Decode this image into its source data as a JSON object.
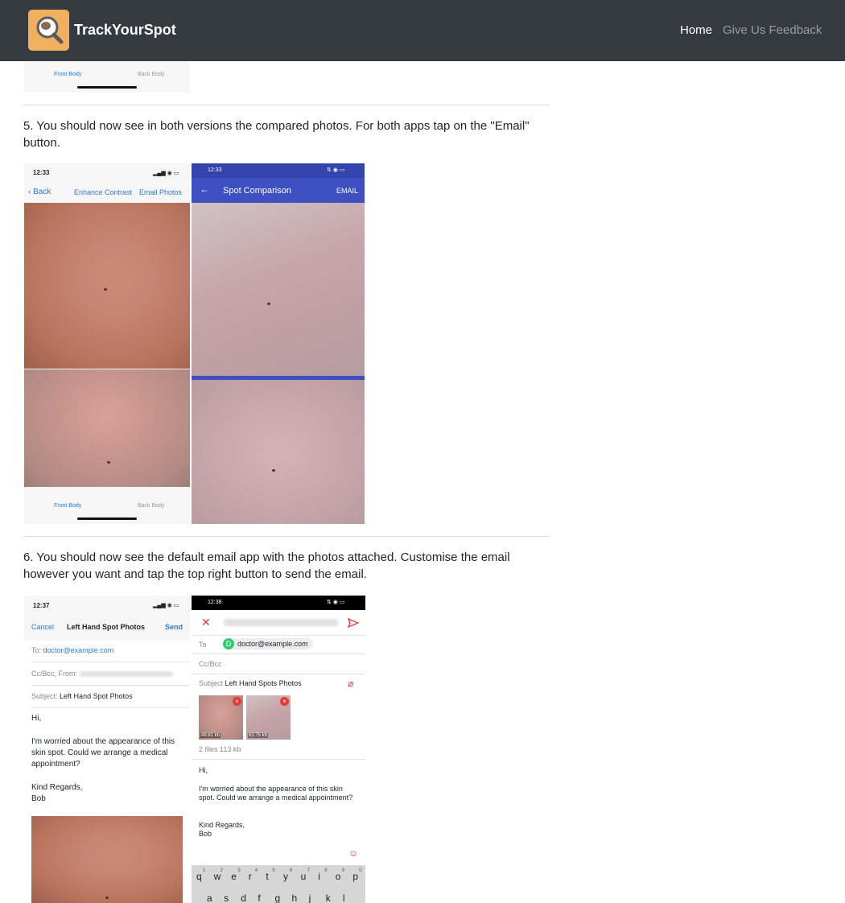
{
  "nav": {
    "brand": "TrackYourSpot",
    "home": "Home",
    "feedback": "Give Us Feedback"
  },
  "top_screenshot": {
    "front_tab": "Front Body",
    "back_tab": "Back Body"
  },
  "step5": {
    "text": "5. You should now see in both versions the compared photos. For both apps tap on the \"Email\" button.",
    "ios": {
      "time": "12:33",
      "back": "Back",
      "enhance": "Enhance Contrast",
      "email": "Email Photos",
      "front_tab": "Front Body",
      "back_tab": "Back Body"
    },
    "android": {
      "time": "12:33",
      "title": "Spot Comparison",
      "email": "EMAIL"
    }
  },
  "step6": {
    "text": "6. You should now see the default email app with the photos attached. Customise the email however you want and tap the top right button to send the email.",
    "ios": {
      "time": "12:37",
      "cancel": "Cancel",
      "title": "Left Hand Spot Photos",
      "send": "Send",
      "to_label": "To:",
      "to_value": "doctor@example.com",
      "cc_label": "Cc/Bcc, From:",
      "subject_label": "Subject:",
      "subject_value": "Left Hand Spot Photos",
      "body_greeting": "Hi,",
      "body_text": "I'm worried about the appearance of this skin spot. Could we arrange a medical appointment?",
      "body_regards": "Kind Regards,",
      "body_name": "Bob"
    },
    "android": {
      "time": "12:38",
      "to_label": "To",
      "chip_initial": "D",
      "to_value": "doctor@example.com",
      "cc_label": "Cc/Bcc",
      "subject_label": "Subject",
      "subject_value": "Left Hand Spots Photos",
      "attach1_size": "49.81 kb",
      "attach2_size": "62.75 kb",
      "files_summary": "2 files 113 kb",
      "body_greeting": "Hi,",
      "body_text": "I'm worried about the appearance of this skin spot. Could we arrange a medical appointment?",
      "body_regards": "Kind Regards,",
      "body_name": "Bob",
      "keyboard_row1": [
        "q",
        "w",
        "e",
        "r",
        "t",
        "y",
        "u",
        "i",
        "o",
        "p"
      ],
      "keyboard_row1_hints": [
        "1",
        "2",
        "3",
        "4",
        "5",
        "6",
        "7",
        "8",
        "9",
        "0"
      ],
      "keyboard_row2": [
        "a",
        "s",
        "d",
        "f",
        "g",
        "h",
        "j",
        "k",
        "l"
      ]
    }
  },
  "colors": {
    "navbar": "#343a40",
    "ios_blue": "#2f7ad6",
    "material_blue": "#3e4fc1",
    "delete_red": "#e53935"
  }
}
